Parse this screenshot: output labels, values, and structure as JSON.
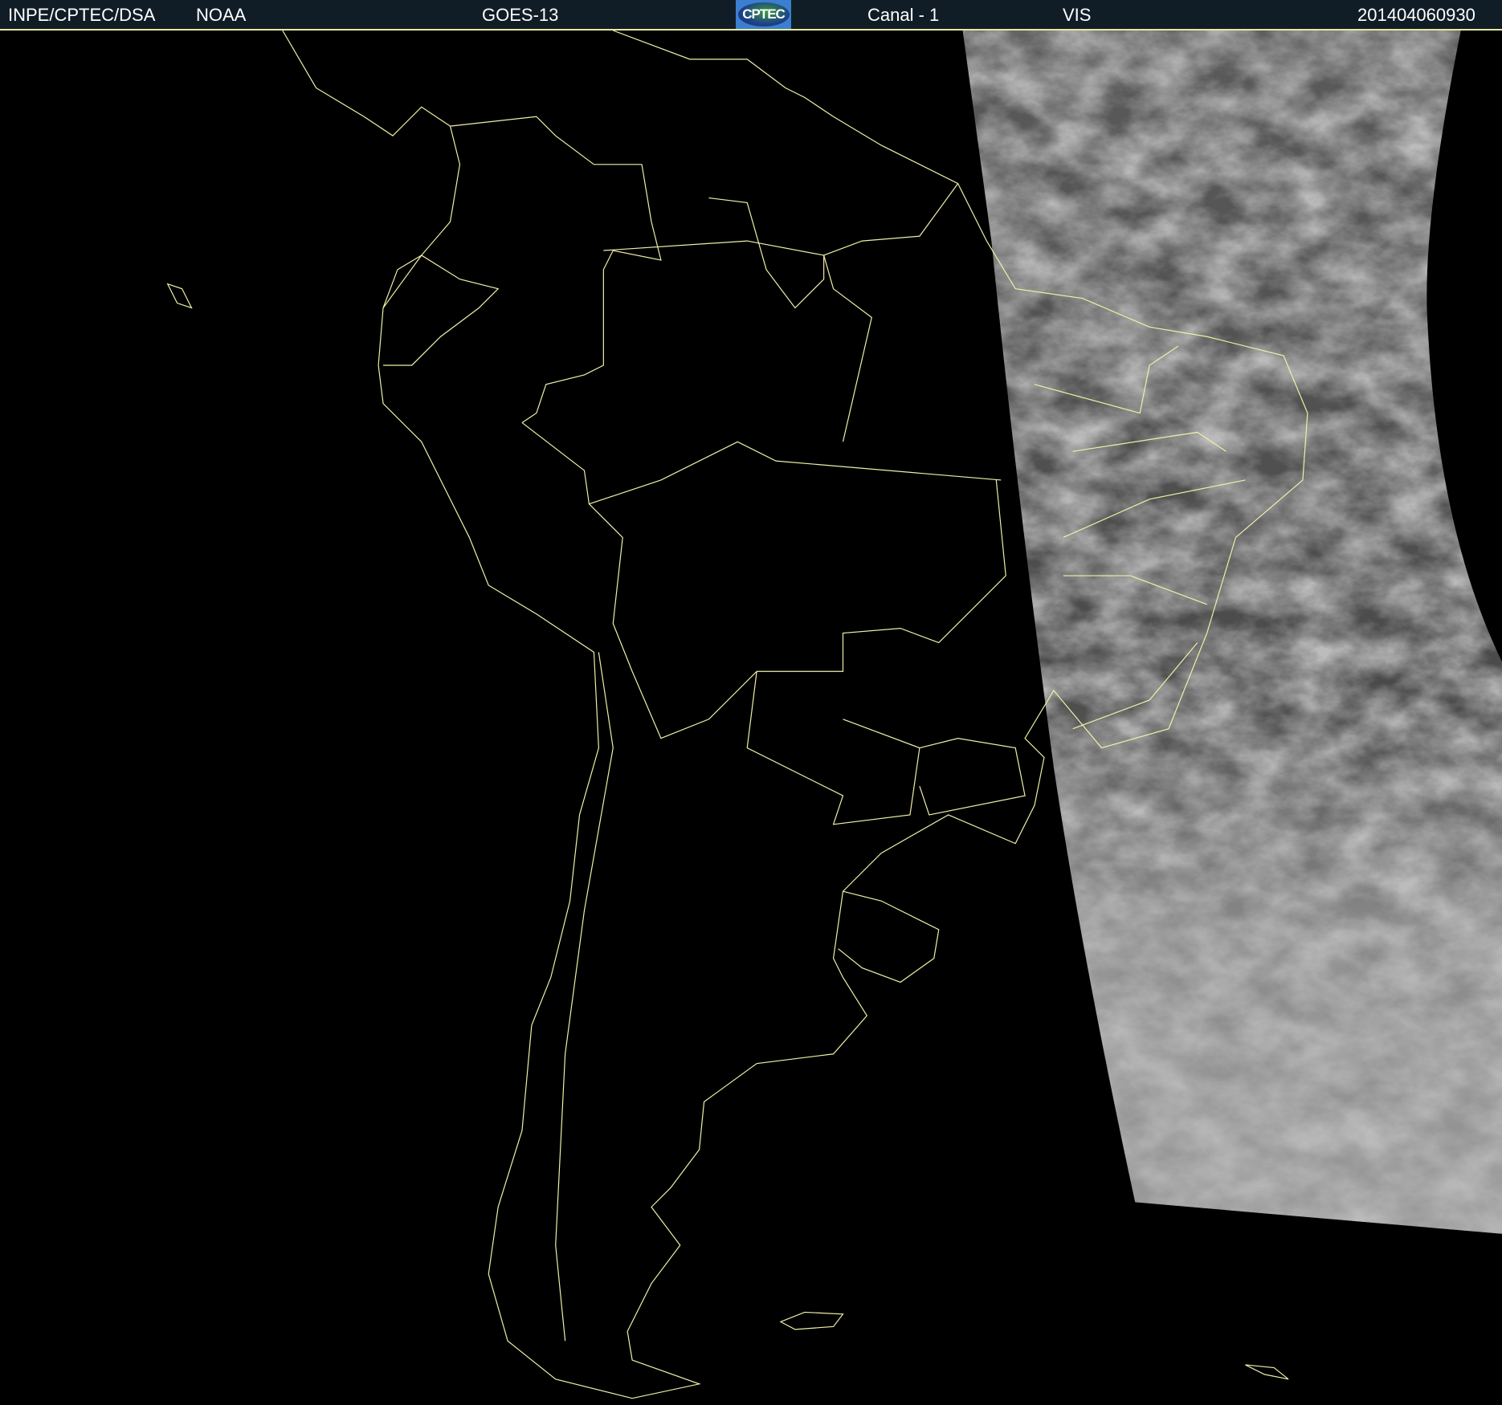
{
  "header": {
    "institution": "INPE/CPTEC/DSA",
    "agency": "NOAA",
    "satellite": "GOES-13",
    "logo_text": "CPTEC",
    "channel": "Canal - 1",
    "band": "VIS",
    "timestamp": "201404060930"
  },
  "map": {
    "region": "South America",
    "border_color": "#f0f0a8",
    "background_color": "#000000"
  }
}
